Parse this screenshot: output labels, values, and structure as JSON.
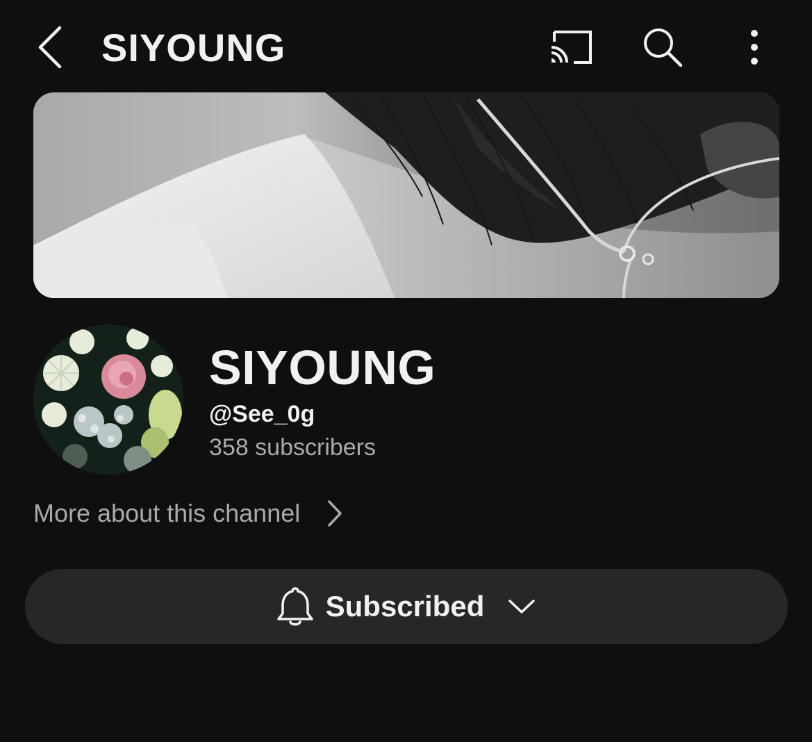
{
  "topbar": {
    "title": "SIYOUNG",
    "icons": {
      "back": "back-arrow-icon",
      "cast": "cast-icon",
      "search": "search-icon",
      "more": "more-vert-icon"
    }
  },
  "channel": {
    "name": "SIYOUNG",
    "handle": "@See_0g",
    "subscribers": "358 subscribers",
    "more_about": "More about this channel"
  },
  "subscribe": {
    "label": "Subscribed",
    "icon": "bell-icon",
    "dropdown_icon": "chevron-down-icon"
  },
  "colors": {
    "background": "#0f0f0f",
    "text_primary": "#f1f1f1",
    "text_secondary": "#aaaaaa",
    "button_background": "#272727"
  }
}
